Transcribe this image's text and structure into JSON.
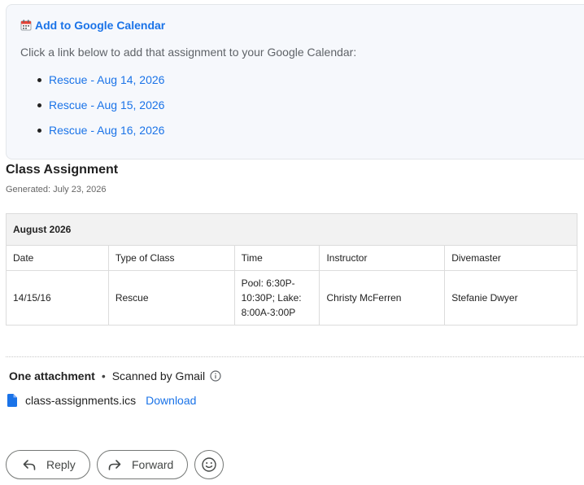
{
  "calendar_box": {
    "title": "Add to Google Calendar",
    "intro": "Click a link below to add that assignment to your Google Calendar:",
    "links": [
      "Rescue - Aug 14, 2026",
      "Rescue - Aug 15, 2026",
      "Rescue - Aug 16, 2026"
    ]
  },
  "assignment": {
    "title": "Class Assignment",
    "generated": "Generated: July 23, 2026"
  },
  "table": {
    "month": "August 2026",
    "headers": [
      "Date",
      "Type of Class",
      "Time",
      "Instructor",
      "Divemaster"
    ],
    "row": {
      "date": "14/15/16",
      "type": "Rescue",
      "time": "Pool: 6:30P-10:30P; Lake: 8:00A-3:00P",
      "instructor": "Christy McFerren",
      "divemaster": "Stefanie Dwyer"
    }
  },
  "attachments": {
    "count_label": "One attachment",
    "separator": "•",
    "scan_label": "Scanned by Gmail",
    "file_name": "class-assignments.ics",
    "download_label": "Download"
  },
  "actions": {
    "reply_label": "Reply",
    "forward_label": "Forward"
  },
  "colors": {
    "link": "#1a73e8",
    "file_icon": "#1a73e8",
    "calendar_icon": "#ea4335"
  }
}
